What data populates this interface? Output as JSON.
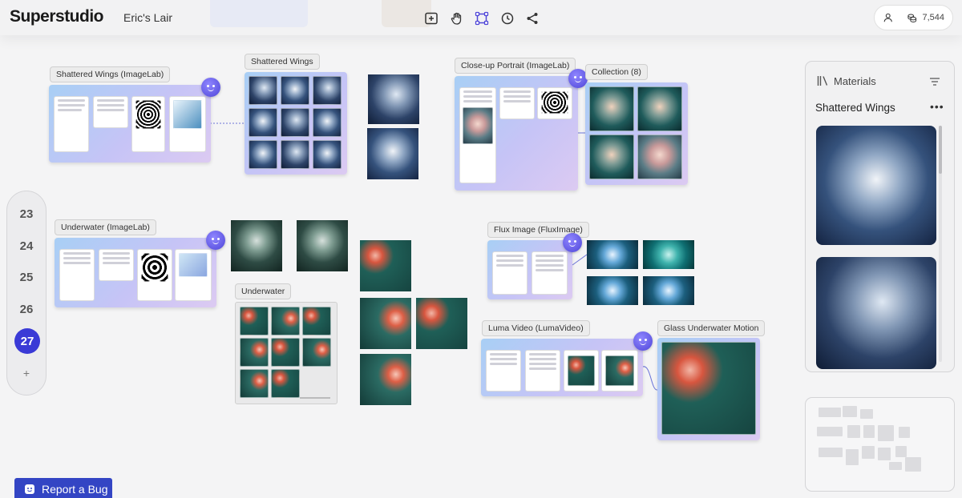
{
  "app": {
    "title": "Superstudio",
    "workspace": "Eric's Lair"
  },
  "toolbar": {
    "tools": [
      {
        "name": "add-frame",
        "icon": "plus-square-icon"
      },
      {
        "name": "pan",
        "icon": "hand-icon"
      },
      {
        "name": "select",
        "icon": "select-box-icon",
        "active": true
      },
      {
        "name": "history",
        "icon": "clock-icon"
      },
      {
        "name": "share",
        "icon": "share-icon"
      }
    ],
    "accent": "#4f46d8"
  },
  "account": {
    "credits": "7,544"
  },
  "pager": {
    "pages": [
      "23",
      "24",
      "25",
      "26",
      "27"
    ],
    "active": "27",
    "add_label": "+"
  },
  "nodes": {
    "shattered_imagelab": "Shattered Wings (ImageLab)",
    "shattered_wings": "Shattered Wings",
    "closeup_imagelab": "Close-up Portrait (ImageLab)",
    "collection": "Collection (8)",
    "underwater_imagelab": "Underwater (ImageLab)",
    "underwater": "Underwater",
    "flux_image": "Flux Image (FluxImage)",
    "luma_video": "Luma Video (LumaVideo)",
    "glass_motion": "Glass Underwater Motion"
  },
  "materials": {
    "title": "Materials",
    "folder": "Shattered Wings"
  },
  "footer": {
    "report_bug": "Report a Bug"
  },
  "colors": {
    "accent": "#3a3ad6",
    "bug_button": "#3345c4",
    "node_gradient_start": "#a8cff5",
    "node_gradient_end": "#dccaf2"
  }
}
